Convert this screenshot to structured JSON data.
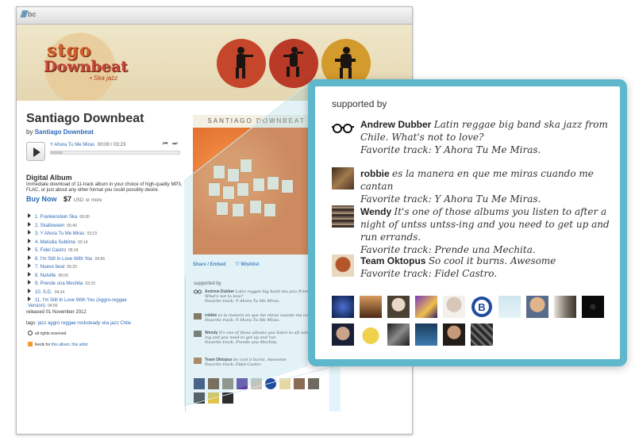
{
  "browser": {
    "logo_text": "bc"
  },
  "band_logo": {
    "line1": "stgo",
    "line2": "Downbeat",
    "line3": "• Ska jazz"
  },
  "album": {
    "title": "Santiago Downbeat",
    "by_prefix": "by",
    "artist": "Santiago Downbeat",
    "cover_band_text": "SANTIAGO DOWNBEAT"
  },
  "player": {
    "track": "Y Ahora Tu Me Miras",
    "time": "00:00 / 03:23",
    "nav": "⏮ ⏭",
    "progress_fraction": 0
  },
  "digital": {
    "title": "Digital Album",
    "desc": "Immediate download of 11-track album in your choice of high-quality MP3, FLAC, or just about any other format you could possibly desire.",
    "buy_label": "Buy Now",
    "price": "$7",
    "currency": "USD",
    "more": "or more"
  },
  "tracks": [
    {
      "title": "1. Frankenstein Ska",
      "dur": "06:00"
    },
    {
      "title": "2. Skalloween",
      "dur": "05:40"
    },
    {
      "title": "3. Y Ahora Tu Me Miras",
      "dur": "03:23"
    },
    {
      "title": "4. Melodia Sublime",
      "dur": "03:14"
    },
    {
      "title": "5. Fidel Castro",
      "dur": "06:24"
    },
    {
      "title": "6. I'm Still In Love With You",
      "dur": "04:56"
    },
    {
      "title": "7. Nuevo beat",
      "dur": "05:20"
    },
    {
      "title": "8. Nutville",
      "dur": "05:00"
    },
    {
      "title": "9. Prende una Mechita",
      "dur": "03:23"
    },
    {
      "title": "10. S.D.",
      "dur": "04:24"
    },
    {
      "title": "11. I'm Still In Love With You (Aggro-reggae Version)",
      "dur": "04:56"
    }
  ],
  "released": "released 01 November 2012",
  "tags": {
    "label": "tags:",
    "items": "jazz aggro reggae rocksteady ska jazz Chile"
  },
  "rights": "all rights reserved",
  "feeds": {
    "label": "feeds for",
    "links": "this album, this artist"
  },
  "share": {
    "share_label": "Share / Embed",
    "wishlist_label": "♡ Wishlist"
  },
  "supported": {
    "heading": "supported by",
    "entries": [
      {
        "name": "Andrew Dubber",
        "comment": "Latin reggae big band ska jazz from Chile. What's not to love?",
        "fav": "Favorite track: Y Ahora Tu Me Miras."
      },
      {
        "name": "robbie",
        "comment": "es la manera en que me miras cuando me cantan",
        "fav": "Favorite track: Y Ahora Tu Me Miras."
      },
      {
        "name": "Wendy",
        "comment": "It's one of those albums you listen to after a night of untss untss-ing and you need to get up and run errands.",
        "fav": "Favorite track: Prende una Mechita."
      },
      {
        "name": "Team Oktopus",
        "comment": "So cool it burns. Awesome",
        "fav": "Favorite track: Fidel Castro."
      }
    ],
    "mini_entries": [
      {
        "name": "Andrew Dubber",
        "comment": "Latin reggae big band ska jazz from Chile. What's not to love?",
        "fav": "Favorite track: Y Ahora Tu Me Miras."
      },
      {
        "name": "robbie",
        "comment": "es la manera en que me miras cuando me cantan",
        "fav": "Favorite track: Y Ahora Tu Me Miras."
      },
      {
        "name": "Wendy",
        "comment": "It's one of those albums you listen to aft untss untss-ing and you need to get up and run",
        "fav": "Favorite track: Prende una Mechita."
      },
      {
        "name": "Team Oktopus",
        "comment": "So cool it burns. Awesome",
        "fav": "Favorite track: Fidel Castro."
      }
    ]
  },
  "colors": {
    "link": "#2c69b4",
    "callout_border": "#5fb7cc",
    "banner": "#ece1bf",
    "cover_orange": "#e26f2e",
    "disc_colors": [
      "#c5462b",
      "#b83a27",
      "#d39a2c"
    ]
  },
  "icons": {
    "andrew": "glasses-icon",
    "robbie": "avatar-photo",
    "wendy": "avatar-photo",
    "oktopus": "avatar-photo"
  }
}
